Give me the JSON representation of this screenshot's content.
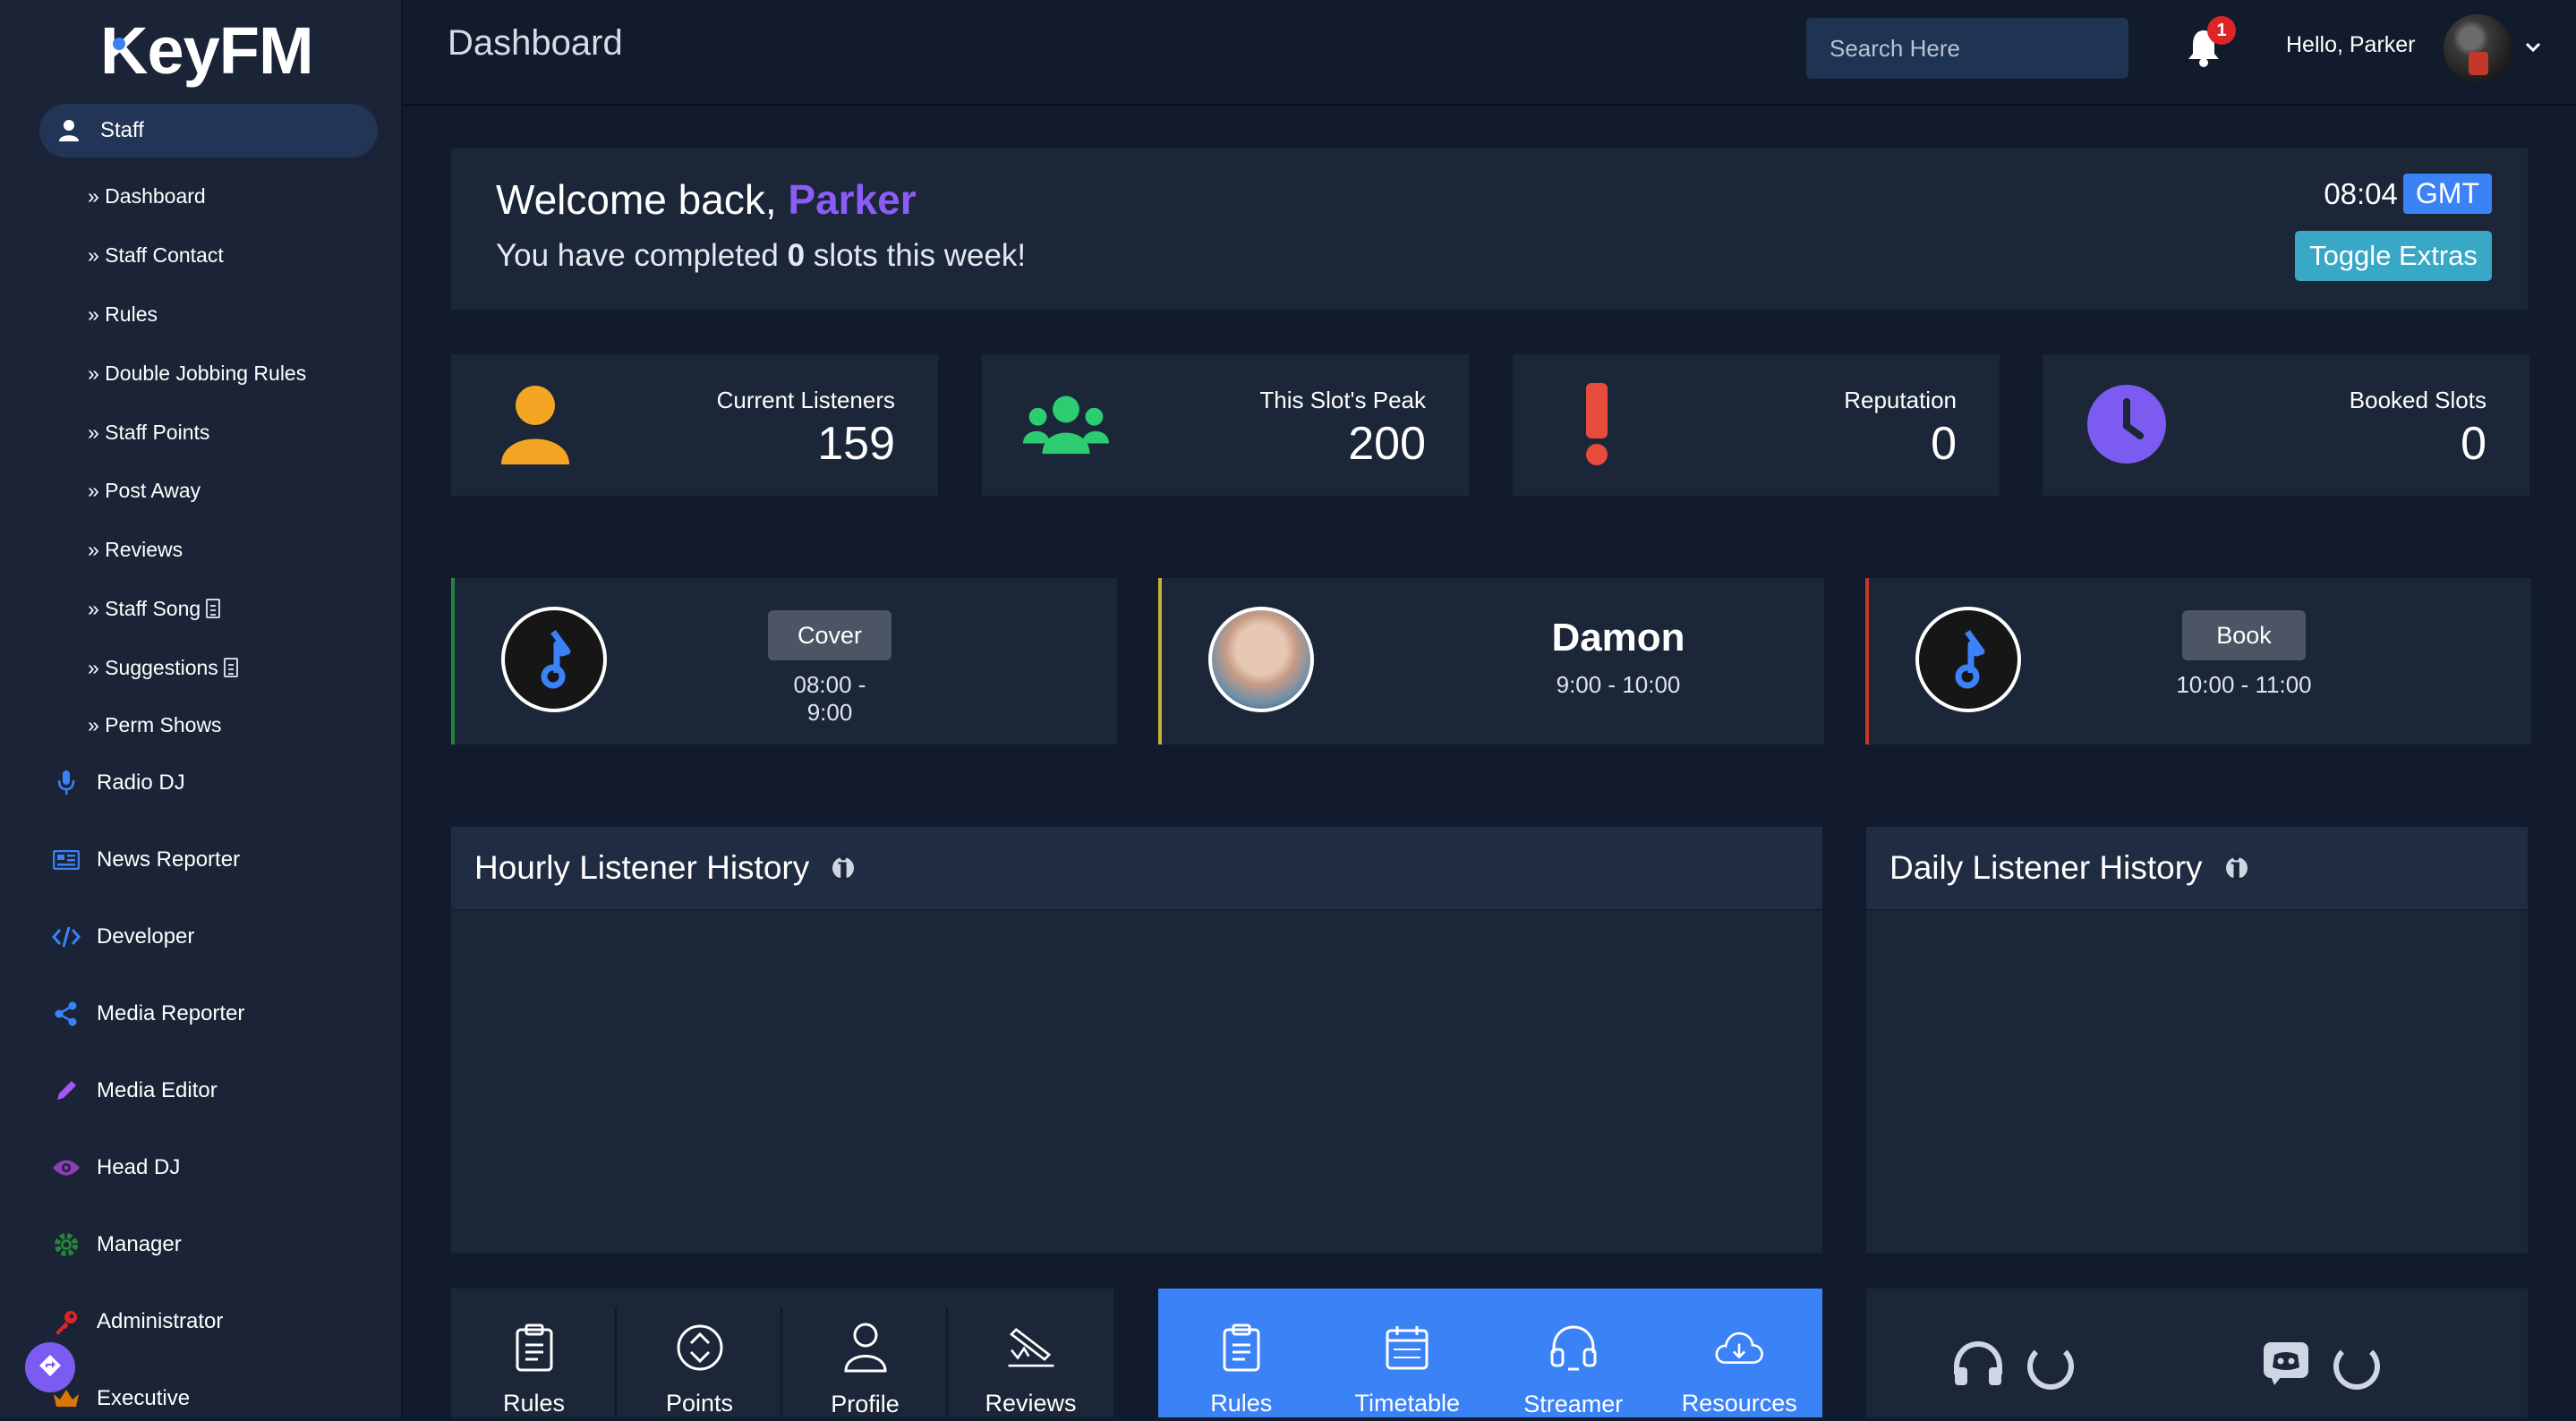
{
  "app": {
    "logo_text": "KeyFM"
  },
  "sidebar": {
    "section_label": "Staff",
    "sub_items": [
      {
        "label": "» Dashboard"
      },
      {
        "label": "» Staff Contact"
      },
      {
        "label": "» Rules"
      },
      {
        "label": "» Double Jobbing Rules"
      },
      {
        "label": "» Staff Points"
      },
      {
        "label": "» Post Away"
      },
      {
        "label": "» Reviews"
      },
      {
        "label": "» Staff Song",
        "icon": "document-icon"
      },
      {
        "label": "» Suggestions",
        "icon": "document-icon"
      },
      {
        "label": "» Perm Shows"
      }
    ],
    "roles": [
      {
        "label": "Radio DJ",
        "icon": "microphone-icon",
        "color": "#3b82f6"
      },
      {
        "label": "News Reporter",
        "icon": "newspaper-icon",
        "color": "#3b82f6"
      },
      {
        "label": "Developer",
        "icon": "code-icon",
        "color": "#3b82f6"
      },
      {
        "label": "Media Reporter",
        "icon": "share-icon",
        "color": "#3b82f6"
      },
      {
        "label": "Media Editor",
        "icon": "pencil-icon",
        "color": "#a855f7"
      },
      {
        "label": "Head DJ",
        "icon": "eye-icon",
        "color": "#8b3fb5"
      },
      {
        "label": "Manager",
        "icon": "gear-icon",
        "color": "#22863a"
      },
      {
        "label": "Administrator",
        "icon": "key-icon",
        "color": "#dc2626"
      },
      {
        "label": "Executive",
        "icon": "crown-icon",
        "color": "#d97706"
      }
    ]
  },
  "header": {
    "title": "Dashboard",
    "search_placeholder": "Search Here",
    "notification_count": "1",
    "greeting": "Hello, Parker"
  },
  "welcome": {
    "prefix": "Welcome back, ",
    "name": "Parker",
    "slots_prefix": "You have completed ",
    "slots_count": "0",
    "slots_suffix": " slots this week!",
    "time": "08:04",
    "timezone": "GMT",
    "toggle_label": "Toggle Extras"
  },
  "stats": [
    {
      "label": "Current Listeners",
      "value": "159",
      "icon": "user-icon",
      "color": "#f5a524"
    },
    {
      "label": "This Slot's Peak",
      "value": "200",
      "icon": "users-icon",
      "color": "#2ecc71"
    },
    {
      "label": "Reputation",
      "value": "0",
      "icon": "exclamation-icon",
      "color": "#e74c3c"
    },
    {
      "label": "Booked Slots",
      "value": "0",
      "icon": "clock-icon",
      "color": "#7c5cf0"
    }
  ],
  "slots": [
    {
      "button": "Cover",
      "time": "08:00 - 9:00",
      "accent": "#22863a"
    },
    {
      "dj": "Damon",
      "time": "9:00 - 10:00",
      "accent": "#c9b037"
    },
    {
      "button": "Book",
      "time": "10:00 - 11:00",
      "accent": "#c0392b"
    }
  ],
  "panels": {
    "hourly_title": "Hourly Listener History",
    "daily_title": "Daily Listener History"
  },
  "quick_links_a": [
    {
      "label": "Rules",
      "icon": "clipboard-icon"
    },
    {
      "label": "Points",
      "icon": "sort-circle-icon"
    },
    {
      "label": "Profile",
      "icon": "user-outline-icon"
    },
    {
      "label": "Reviews",
      "icon": "signature-icon"
    }
  ],
  "quick_links_b": [
    {
      "label": "Rules",
      "icon": "clipboard-icon"
    },
    {
      "label": "Timetable",
      "icon": "calendar-icon"
    },
    {
      "label": "Streamer",
      "icon": "headset-icon"
    },
    {
      "label": "Resources",
      "icon": "cloud-download-icon"
    }
  ]
}
